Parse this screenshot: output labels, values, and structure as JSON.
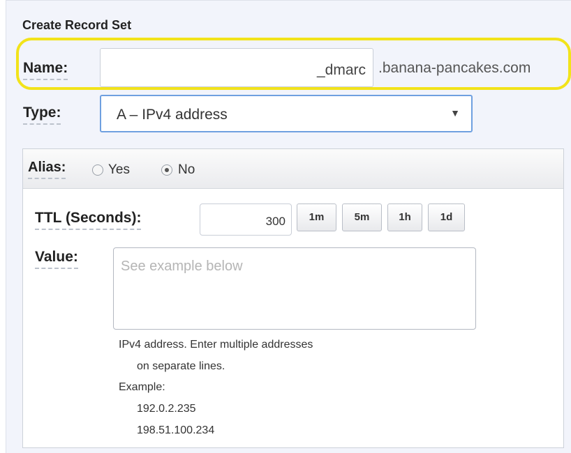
{
  "form": {
    "title": "Create Record Set",
    "name": {
      "label": "Name:",
      "value": "_dmarc",
      "suffix": ".banana-pancakes.com"
    },
    "type": {
      "label": "Type:",
      "selected": "A – IPv4 address"
    },
    "alias": {
      "label": "Alias:",
      "options": [
        "Yes",
        "No"
      ],
      "selected": "No"
    },
    "ttl": {
      "label": "TTL (Seconds):",
      "value": "300",
      "buttons": [
        "1m",
        "5m",
        "1h",
        "1d"
      ]
    },
    "value_field": {
      "label": "Value:",
      "placeholder": "See example below",
      "help_line1": "IPv4 address. Enter multiple addresses",
      "help_line2": "on separate lines.",
      "example_label": "Example:",
      "examples": [
        "192.0.2.235",
        "198.51.100.234"
      ]
    }
  },
  "colors": {
    "highlight": "#f2e31a",
    "focus_border": "#6fa0e0"
  },
  "icons": {
    "select_arrow": "dropdown-arrow-icon"
  }
}
